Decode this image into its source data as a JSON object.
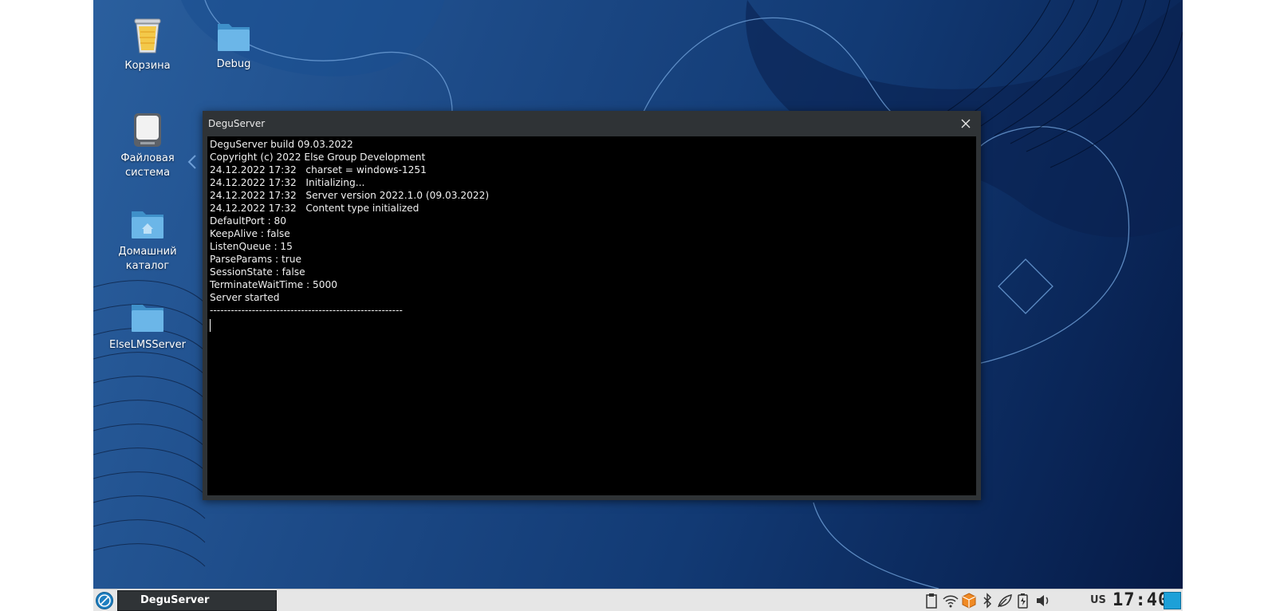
{
  "desktop": {
    "icons": [
      {
        "label": "Корзина"
      },
      {
        "label": "Debug"
      },
      {
        "label": "Файловая система"
      },
      {
        "label": "Домашний каталог"
      },
      {
        "label": "ElseLMSServer"
      }
    ]
  },
  "window": {
    "title": "DeguServer",
    "console_lines": [
      "DeguServer build 09.03.2022",
      "Copyright (c) 2022 Else Group Development",
      "24.12.2022 17:32   charset = windows-1251",
      "24.12.2022 17:32   Initializing...",
      "24.12.2022 17:32   Server version 2022.1.0 (09.03.2022)",
      "24.12.2022 17:32   Content type initialized",
      "DefaultPort : 80",
      "KeepAlive : false",
      "ListenQueue : 15",
      "ParseParams : true",
      "SessionState : false",
      "TerminateWaitTime : 5000",
      "Server started",
      "-------------------------------------------------------"
    ]
  },
  "taskbar": {
    "task_label": "DeguServer",
    "keyboard_layout": "US",
    "clock": "17:40"
  },
  "colors": {
    "console_bg": "#000000",
    "window_frame": "#2f3336",
    "desktop_accent": "#1ca0d8"
  }
}
